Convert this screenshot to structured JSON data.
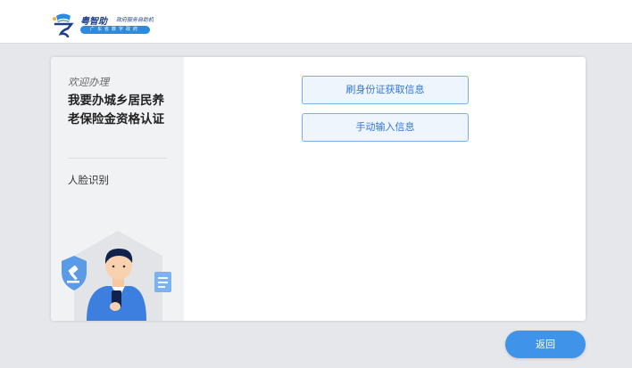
{
  "header": {
    "logo_name": "粤智助",
    "logo_subtitle": "政府服务自助机",
    "logo_pill": "广东省数字政府",
    "brand_color": "#1d3f8c",
    "accent_color": "#2a8be0"
  },
  "sidebar": {
    "welcome": "欢迎办理",
    "title": "我要办城乡居民养老保险金资格认证",
    "step": "人脸识别",
    "illustration_icons": [
      "shield-hammer-icon",
      "person-with-phone-icon",
      "document-icon"
    ]
  },
  "main": {
    "buttons": [
      {
        "label": "刷身份证获取信息"
      },
      {
        "label": "手动输入信息"
      }
    ]
  },
  "footer": {
    "back_label": "返回",
    "back_color": "#3f93e8"
  }
}
